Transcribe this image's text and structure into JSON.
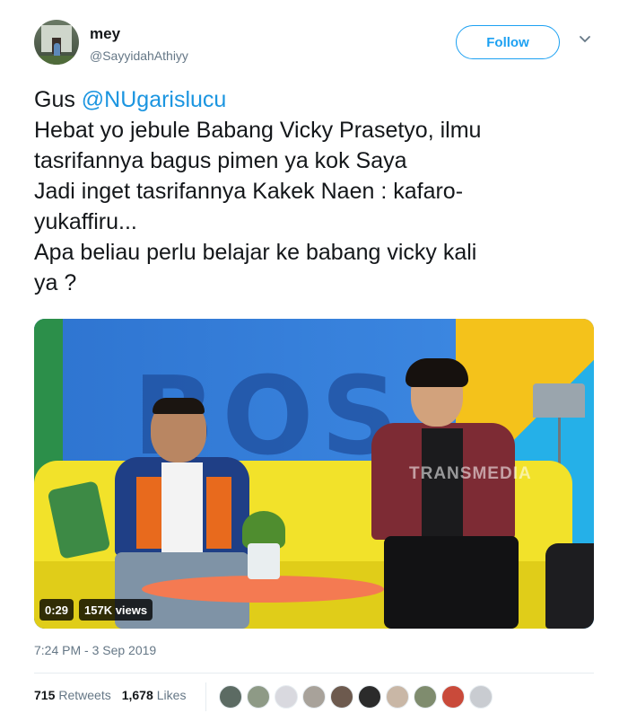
{
  "user": {
    "name": "mey",
    "handle": "@SayyidahAthiyy",
    "follow_label": "Follow"
  },
  "tweet": {
    "prefix": "Gus ",
    "mention": "@NUgarislucu",
    "body": "Hebat yo jebule Babang Vicky Prasetyo, ilmu\ntasrifannya bagus pimen ya kok Saya\nJadi inget tasrifannya Kakek Naen : kafaro-\nyukaffiru...\nApa beliau perlu belajar ke babang vicky kali\nya ?"
  },
  "video": {
    "duration": "0:29",
    "views": "157K views",
    "watermark": "TRANSMEDIA"
  },
  "timestamp": "7:24 PM - 3 Sep 2019",
  "stats": {
    "retweets_count": "715",
    "retweets_label": "Retweets",
    "likes_count": "1,678",
    "likes_label": "Likes"
  },
  "likers_colors": [
    "#5c6b63",
    "#8e9a86",
    "#d9d9df",
    "#a8a29a",
    "#6d5a4e",
    "#2b2b2b",
    "#c9b7a6",
    "#7f8c6e",
    "#c94a3a",
    "#c9ccd1"
  ],
  "colors": {
    "accent": "#1da1f2",
    "mention": "#1b95e0",
    "muted": "#657786"
  }
}
